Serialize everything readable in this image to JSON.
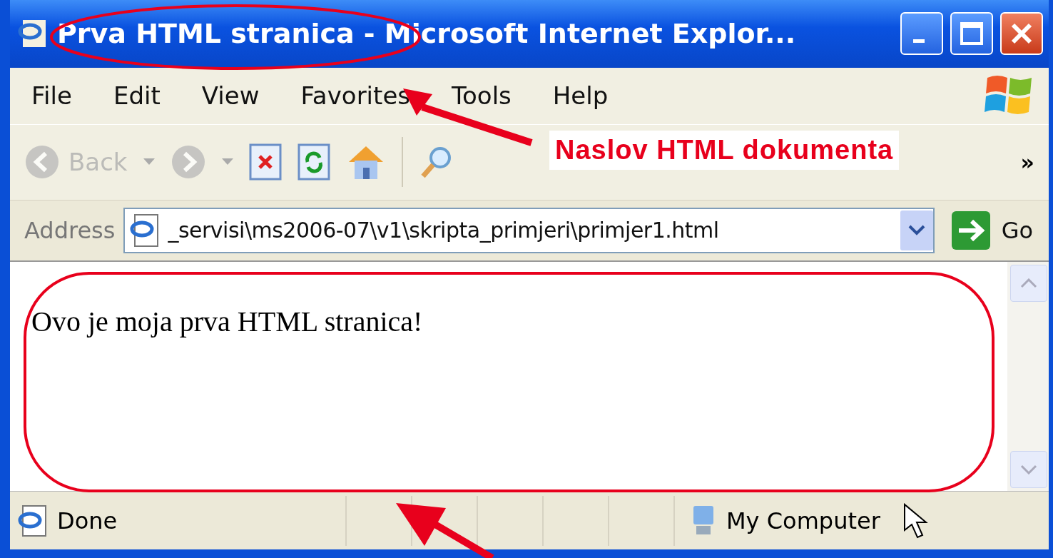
{
  "window": {
    "title": "Prva HTML stranica - Microsoft Internet Explor..."
  },
  "menu": [
    "File",
    "Edit",
    "View",
    "Favorites",
    "Tools",
    "Help"
  ],
  "toolbar": {
    "buttons": [
      {
        "kind": "back",
        "label": "Back",
        "disabled": true
      },
      {
        "kind": "forward",
        "disabled": true
      },
      {
        "kind": "stop",
        "disabled": false
      },
      {
        "kind": "refresh",
        "disabled": false
      },
      {
        "kind": "home",
        "disabled": false
      },
      {
        "kind": "search",
        "disabled": false
      }
    ],
    "overflow": "»"
  },
  "address": {
    "label": "Address",
    "value": "_servisi\\ms2006-07\\v1\\skripta_primjeri\\primjer1.html",
    "go": "Go"
  },
  "content": {
    "text": "Ovo je moja prva HTML stranica!"
  },
  "status_bar": {
    "text": "Done",
    "zone": "My Computer"
  },
  "annotation": {
    "callout": "Naslov HTML dokumenta"
  }
}
